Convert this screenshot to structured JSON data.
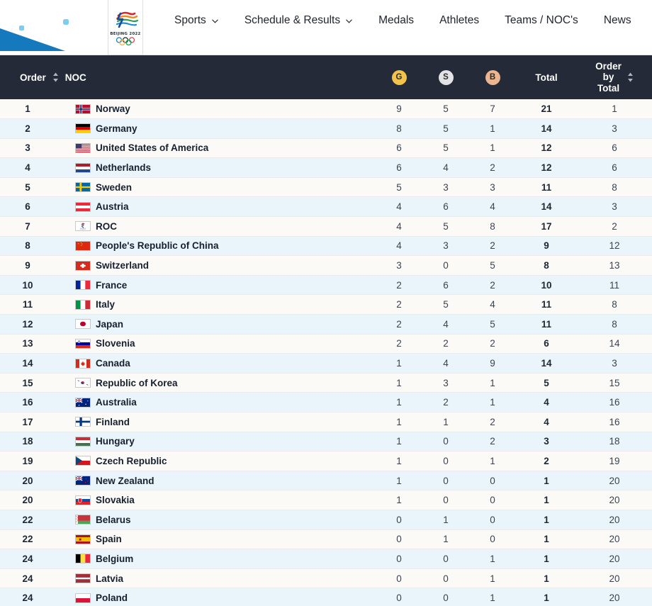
{
  "header": {
    "logo": {
      "wordmark": "BEIJING 2022",
      "icon": "beijing-2022-emblem"
    },
    "nav": [
      {
        "label": "Sports",
        "caret": true
      },
      {
        "label": "Schedule & Results",
        "caret": true
      },
      {
        "label": "Medals",
        "caret": false
      },
      {
        "label": "Athletes",
        "caret": false
      },
      {
        "label": "Teams / NOC's",
        "caret": false
      },
      {
        "label": "News",
        "caret": false
      }
    ]
  },
  "table": {
    "columns": {
      "order": "Order",
      "noc": "NOC",
      "gold": "G",
      "silver": "S",
      "bronze": "B",
      "total": "Total",
      "order_by_total_l1": "Order",
      "order_by_total_l2": "by",
      "order_by_total_l3": "Total"
    },
    "colors": {
      "header_bg": "#252a38",
      "gold": "#f3c24b",
      "silver": "#e2e2e7",
      "bronze": "#eab58f",
      "row_odd": "#fcfaf7",
      "row_even": "#eaf4fb",
      "accent_blue": "#1479bd"
    },
    "rows": [
      {
        "order": "1",
        "noc": "Norway",
        "flag": "no",
        "g": "9",
        "s": "5",
        "b": "7",
        "total": "21",
        "obt": "1"
      },
      {
        "order": "2",
        "noc": "Germany",
        "flag": "de",
        "g": "8",
        "s": "5",
        "b": "1",
        "total": "14",
        "obt": "3"
      },
      {
        "order": "3",
        "noc": "United States of America",
        "flag": "us",
        "g": "6",
        "s": "5",
        "b": "1",
        "total": "12",
        "obt": "6"
      },
      {
        "order": "4",
        "noc": "Netherlands",
        "flag": "nl",
        "g": "6",
        "s": "4",
        "b": "2",
        "total": "12",
        "obt": "6"
      },
      {
        "order": "5",
        "noc": "Sweden",
        "flag": "se",
        "g": "5",
        "s": "3",
        "b": "3",
        "total": "11",
        "obt": "8"
      },
      {
        "order": "6",
        "noc": "Austria",
        "flag": "at",
        "g": "4",
        "s": "6",
        "b": "4",
        "total": "14",
        "obt": "3"
      },
      {
        "order": "7",
        "noc": "ROC",
        "flag": "roc",
        "g": "4",
        "s": "5",
        "b": "8",
        "total": "17",
        "obt": "2"
      },
      {
        "order": "8",
        "noc": "People's Republic of China",
        "flag": "cn",
        "g": "4",
        "s": "3",
        "b": "2",
        "total": "9",
        "obt": "12"
      },
      {
        "order": "9",
        "noc": "Switzerland",
        "flag": "ch",
        "g": "3",
        "s": "0",
        "b": "5",
        "total": "8",
        "obt": "13"
      },
      {
        "order": "10",
        "noc": "France",
        "flag": "fr",
        "g": "2",
        "s": "6",
        "b": "2",
        "total": "10",
        "obt": "11"
      },
      {
        "order": "11",
        "noc": "Italy",
        "flag": "it",
        "g": "2",
        "s": "5",
        "b": "4",
        "total": "11",
        "obt": "8"
      },
      {
        "order": "12",
        "noc": "Japan",
        "flag": "jp",
        "g": "2",
        "s": "4",
        "b": "5",
        "total": "11",
        "obt": "8"
      },
      {
        "order": "13",
        "noc": "Slovenia",
        "flag": "si",
        "g": "2",
        "s": "2",
        "b": "2",
        "total": "6",
        "obt": "14"
      },
      {
        "order": "14",
        "noc": "Canada",
        "flag": "ca",
        "g": "1",
        "s": "4",
        "b": "9",
        "total": "14",
        "obt": "3"
      },
      {
        "order": "15",
        "noc": "Republic of Korea",
        "flag": "kr",
        "g": "1",
        "s": "3",
        "b": "1",
        "total": "5",
        "obt": "15"
      },
      {
        "order": "16",
        "noc": "Australia",
        "flag": "au",
        "g": "1",
        "s": "2",
        "b": "1",
        "total": "4",
        "obt": "16"
      },
      {
        "order": "17",
        "noc": "Finland",
        "flag": "fi",
        "g": "1",
        "s": "1",
        "b": "2",
        "total": "4",
        "obt": "16"
      },
      {
        "order": "18",
        "noc": "Hungary",
        "flag": "hu",
        "g": "1",
        "s": "0",
        "b": "2",
        "total": "3",
        "obt": "18"
      },
      {
        "order": "19",
        "noc": "Czech Republic",
        "flag": "cz",
        "g": "1",
        "s": "0",
        "b": "1",
        "total": "2",
        "obt": "19"
      },
      {
        "order": "20",
        "noc": "New Zealand",
        "flag": "nz",
        "g": "1",
        "s": "0",
        "b": "0",
        "total": "1",
        "obt": "20"
      },
      {
        "order": "20",
        "noc": "Slovakia",
        "flag": "sk",
        "g": "1",
        "s": "0",
        "b": "0",
        "total": "1",
        "obt": "20"
      },
      {
        "order": "22",
        "noc": "Belarus",
        "flag": "by",
        "g": "0",
        "s": "1",
        "b": "0",
        "total": "1",
        "obt": "20"
      },
      {
        "order": "22",
        "noc": "Spain",
        "flag": "es",
        "g": "0",
        "s": "1",
        "b": "0",
        "total": "1",
        "obt": "20"
      },
      {
        "order": "24",
        "noc": "Belgium",
        "flag": "be",
        "g": "0",
        "s": "0",
        "b": "1",
        "total": "1",
        "obt": "20"
      },
      {
        "order": "24",
        "noc": "Latvia",
        "flag": "lv",
        "g": "0",
        "s": "0",
        "b": "1",
        "total": "1",
        "obt": "20"
      },
      {
        "order": "24",
        "noc": "Poland",
        "flag": "pl",
        "g": "0",
        "s": "0",
        "b": "1",
        "total": "1",
        "obt": "20"
      }
    ]
  }
}
